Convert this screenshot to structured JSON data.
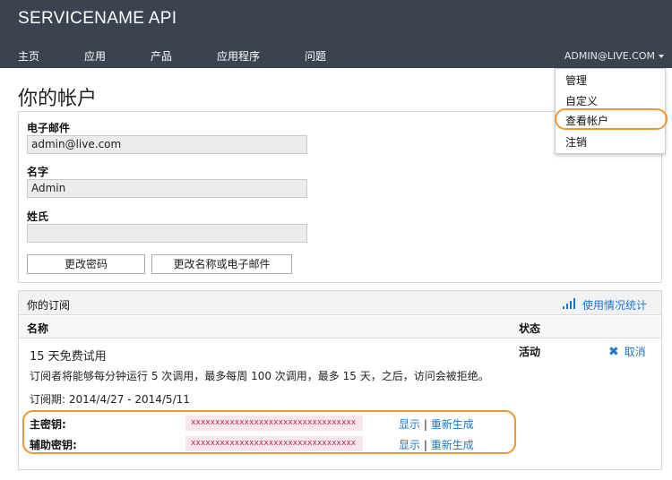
{
  "app": {
    "title": "SERVICENAME API"
  },
  "nav": {
    "items": [
      {
        "label": "主页"
      },
      {
        "label": "应用"
      },
      {
        "label": "产品"
      },
      {
        "label": "应用程序"
      },
      {
        "label": "问题"
      }
    ],
    "user": "ADMIN@LIVE.COM"
  },
  "user_menu": {
    "items": [
      {
        "label": "管理"
      },
      {
        "label": "自定义"
      },
      {
        "label": "查看帐户"
      },
      {
        "label": "注销"
      }
    ]
  },
  "page": {
    "title": "你的帐户"
  },
  "profile": {
    "email_label": "电子邮件",
    "email_value": "admin@live.com",
    "first_name_label": "名字",
    "first_name_value": "Admin",
    "last_name_label": "姓氏",
    "last_name_value": "",
    "change_password_label": "更改密码",
    "change_name_email_label": "更改名称或电子邮件"
  },
  "subscriptions": {
    "title": "你的订阅",
    "usage_label": "使用情况统计",
    "col_name": "名称",
    "col_status": "状态",
    "plan": {
      "name": "15 天免费试用",
      "description": "订阅者将能够每分钟运行 5 次调用，最多每周 100 次调用，最多 15 天，之后，访问会被拒绝。",
      "period": "订阅期: 2014/4/27 - 2014/5/11",
      "status": "活动",
      "cancel_label": "取消"
    },
    "keys": {
      "primary_label": "主密钥:",
      "primary_value": "xxxxxxxxxxxxxxxxxxxxxxxxxxxxxxxxxx",
      "secondary_label": "辅助密钥:",
      "secondary_value": "xxxxxxxxxxxxxxxxxxxxxxxxxxxxxxxxxx",
      "show_label": "显示",
      "separator": "|",
      "regenerate_label": "重新生成"
    }
  },
  "colors": {
    "topbar": "#3c4350",
    "highlight": "#f0962b",
    "link": "#1e76c9",
    "key_text": "#c0225a"
  },
  "icons": {
    "usage": "bar-chart-icon",
    "cancel": "close-x-icon",
    "menu": "caret-down-icon"
  }
}
